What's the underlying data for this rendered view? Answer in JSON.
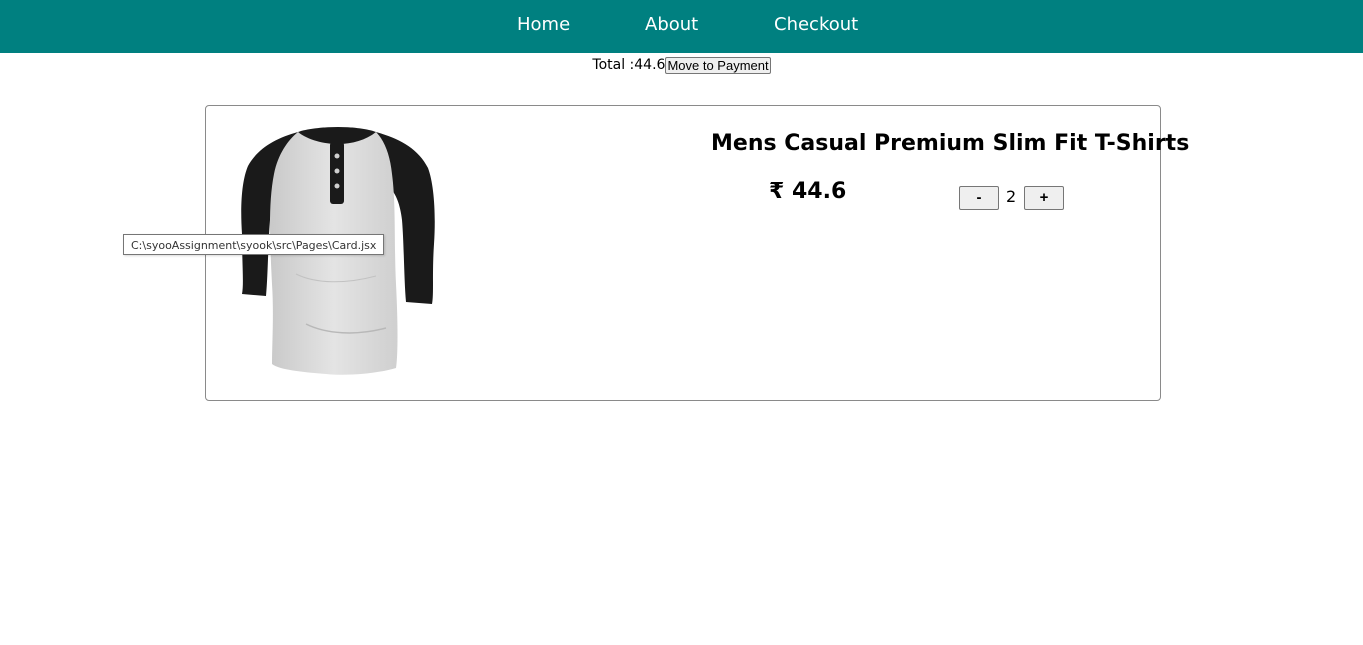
{
  "nav": {
    "home": "Home",
    "about": "About",
    "checkout": "Checkout",
    "background_color": "#008080"
  },
  "summary": {
    "total_label": "Total : ",
    "total_value": "44.6",
    "pay_button": "Move to Payment"
  },
  "cart": {
    "items": [
      {
        "title": "Mens Casual Premium Slim Fit T-Shirts",
        "price": "₹ 44.6",
        "quantity": "2",
        "minus_label": "-",
        "plus_label": "+",
        "image_icon": "raglan-henley-tshirt-image"
      }
    ]
  },
  "tooltip": {
    "text": "C:\\syooAssignment\\syook\\src\\Pages\\Card.jsx"
  }
}
